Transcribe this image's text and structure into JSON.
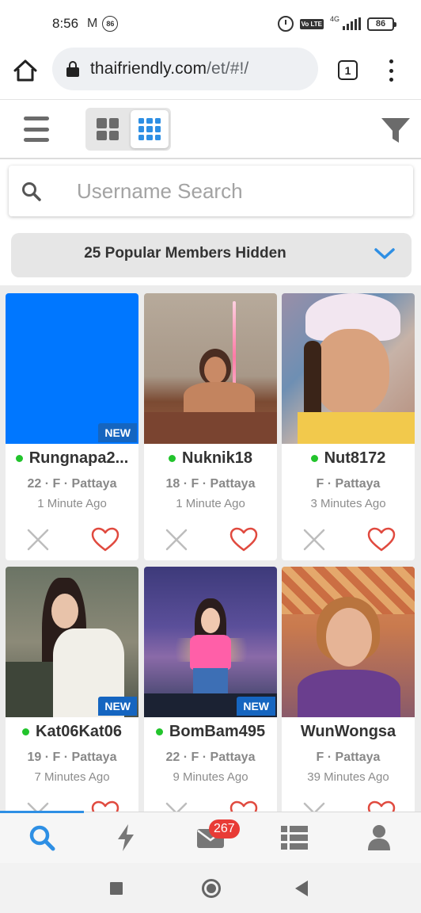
{
  "status_bar": {
    "time": "8:56",
    "mail_indicator": "M",
    "notification_badge": "86",
    "network": "4G",
    "volte": "Vo LTE",
    "battery": "86"
  },
  "browser": {
    "url_domain": "thaifriendly.com",
    "url_path": "/et/#!/",
    "tab_count": "1"
  },
  "search": {
    "placeholder": "Username Search"
  },
  "popular_bar": {
    "text": "25 Popular Members Hidden"
  },
  "colors": {
    "accent": "#2e8fe4",
    "new_badge": "#1565c0",
    "online": "#22c42c",
    "heart": "#e04a3f",
    "badge_red": "#e83b36"
  },
  "members": [
    {
      "name": "Rungnapa2...",
      "info": "22 · F · Pattaya",
      "time": "1 Minute Ago",
      "online": true,
      "new": true,
      "new_label": "NEW"
    },
    {
      "name": "Nuknik18",
      "info": "18 · F · Pattaya",
      "time": "1 Minute Ago",
      "online": true,
      "new": false
    },
    {
      "name": "Nut8172",
      "info": "F · Pattaya",
      "time": "3 Minutes Ago",
      "online": true,
      "new": false
    },
    {
      "name": "Kat06Kat06",
      "info": "19 · F · Pattaya",
      "time": "7 Minutes Ago",
      "online": true,
      "new": true,
      "new_label": "NEW"
    },
    {
      "name": "BomBam495",
      "info": "22 · F · Pattaya",
      "time": "9 Minutes Ago",
      "online": true,
      "new": true,
      "new_label": "NEW"
    },
    {
      "name": "WunWongsa",
      "info": "F · Pattaya",
      "time": "39 Minutes Ago",
      "online": false,
      "new": false
    }
  ],
  "bottom_nav": {
    "items": [
      "search-icon",
      "lightning-icon",
      "mail-icon",
      "list-icon",
      "profile-icon"
    ],
    "mail_badge": "267"
  }
}
